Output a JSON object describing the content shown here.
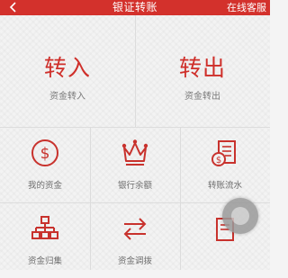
{
  "header": {
    "title": "银证转账",
    "right_link": "在线客服"
  },
  "actions": [
    {
      "label": "转入",
      "sub": "资金转入"
    },
    {
      "label": "转出",
      "sub": "资金转出"
    }
  ],
  "grid": [
    {
      "label": "我的资金",
      "icon": "dollar-coin-icon"
    },
    {
      "label": "银行余额",
      "icon": "crown-icon"
    },
    {
      "label": "转账流水",
      "icon": "statement-icon"
    },
    {
      "label": "资金归集",
      "icon": "hierarchy-icon"
    },
    {
      "label": "资金调拨",
      "icon": "transfer-arrows-icon"
    },
    {
      "label": "",
      "icon": "document-icon"
    }
  ],
  "colors": {
    "brand": "#d3312c",
    "icon": "#c8322d",
    "text_muted": "#6e6e6e"
  }
}
